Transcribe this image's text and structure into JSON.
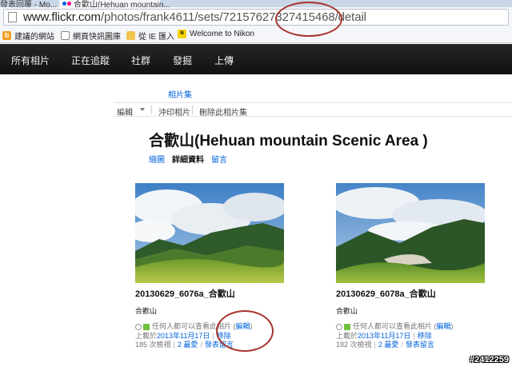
{
  "browser": {
    "tabs": [
      {
        "label": "發表回覆 - Mo..."
      },
      {
        "label": "合歡山(Hehuan mountain..."
      }
    ],
    "url_host": "www.flickr.com",
    "url_path": "/photos/frank4611/sets/72157627327415468/detail",
    "bookmarks": [
      {
        "label": "建議的網站",
        "icon": "bookmark-b-icon"
      },
      {
        "label": "網頁快訊圖庫",
        "icon": "page-icon"
      },
      {
        "label": "從 IE 匯入",
        "icon": "folder-icon"
      },
      {
        "label": "Welcome to Nikon",
        "icon": "nikon-icon"
      }
    ]
  },
  "nav": {
    "items": [
      {
        "label": "所有相片"
      },
      {
        "label": "正在追蹤"
      },
      {
        "label": "社群"
      },
      {
        "label": "發掘"
      },
      {
        "label": "上傳"
      }
    ]
  },
  "breadcrumb": {
    "label": "相片集"
  },
  "toolbar": {
    "edit_label": "編輯",
    "print_label": "沖印相片",
    "delete_label": "刪除此相片集"
  },
  "set": {
    "title": "合歡山(Hehuan mountain Scenic Area )",
    "subtabs": [
      {
        "label": "縮圖"
      },
      {
        "label": "詳細資料"
      },
      {
        "label": "留言"
      }
    ]
  },
  "photos": [
    {
      "title": "20130629_6076a_合歡山",
      "desc": "合歡山",
      "visibility": "任何人都可以查看此相片 (",
      "visibility_edit": "編輯",
      "visibility_end": ")",
      "uploaded_prefix": "上載於 ",
      "uploaded_date": "2013年11月17日",
      "remove": "移除",
      "views": "185 次檢視",
      "faves": "2 最愛",
      "comment": "發表留言"
    },
    {
      "title": "20130629_6078a_合歡山",
      "desc": "合歡山",
      "visibility": "任何人都可以查看此相片 (",
      "visibility_edit": "編輯",
      "visibility_end": ")",
      "uploaded_prefix": "上載於 ",
      "uploaded_date": "2013年11月17日",
      "remove": "移除",
      "views": "182 次檢視",
      "faves": "2 最愛",
      "comment": "發表留言"
    }
  ],
  "watermark": "#2412259",
  "colors": {
    "link": "#0063dc",
    "nav_bg": "#1b1b1b",
    "annotation": "#a8342c"
  }
}
